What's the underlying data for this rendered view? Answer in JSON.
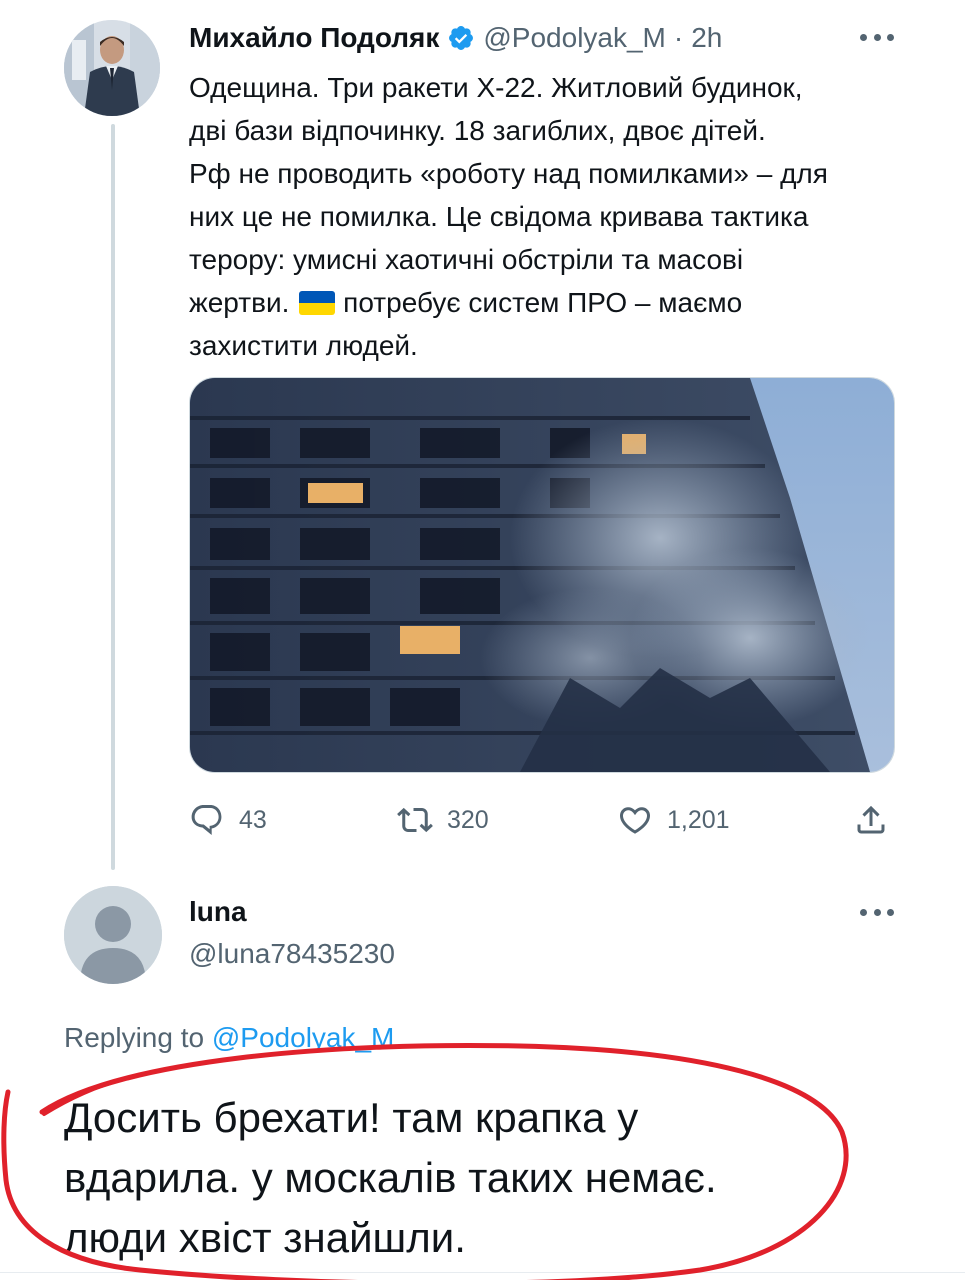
{
  "tweet": {
    "author_name": "Михайло Подоляк",
    "handle": "@Podolyak_M",
    "separator": "·",
    "time": "2h",
    "text_lines": [
      "Одещина. Три ракети Х-22. Житловий будинок,",
      "дві бази відпочинку. 18 загиблих, двоє дітей.",
      "Рф не проводить «роботу над помилками» – для",
      "них це не помилка. Це свідома кривава тактика",
      "терору: умисні хаотичні обстріли та масові",
      "жертви.",
      "потребує систем ПРО – маємо",
      "захистити людей."
    ],
    "flag_emoji": "🇺🇦",
    "media_description": "",
    "actions": {
      "replies": "43",
      "retweets": "320",
      "likes": "1,201"
    }
  },
  "reply": {
    "author_name": "luna",
    "handle": "@luna78435230",
    "replying_prefix": "Replying to",
    "replying_to": "@Podolyak_M",
    "text_lines": [
      "Досить брехати! там крапка у",
      "вдарила. у москалів таких немає.",
      "люди хвіст знайшли."
    ]
  },
  "colors": {
    "text_primary": "#0f1419",
    "text_secondary": "#536471",
    "link_blue": "#1d9bf0",
    "verified_blue": "#1d9bf0",
    "annotation_red": "#e0212b",
    "flag_blue": "#0057b7",
    "flag_yellow": "#ffd700"
  },
  "icons": {
    "reply": "reply-icon",
    "retweet": "retweet-icon",
    "like": "heart-icon",
    "share": "share-icon",
    "more": "more-icon",
    "verified": "verified-badge-icon"
  }
}
